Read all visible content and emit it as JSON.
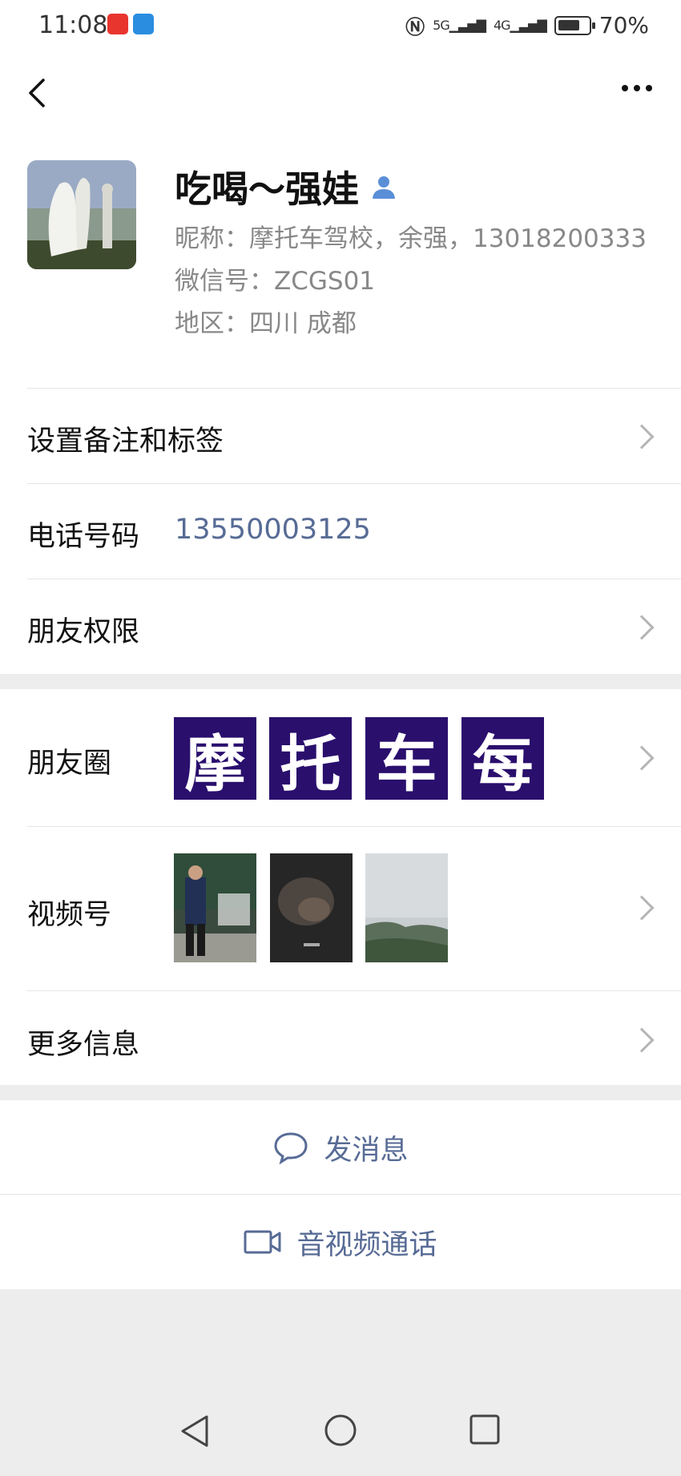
{
  "status_bar": {
    "time": "11:08",
    "signal_label": "5G",
    "signal_label_2": "4G",
    "battery": "70%"
  },
  "profile": {
    "name": "吃喝～强娃",
    "nickname": "昵称：摩托车驾校，余强，13018200333",
    "wechat_id": "微信号：ZCGS01",
    "region": "地区：四川  成都"
  },
  "rows": {
    "remark_label": "设置备注和标签",
    "phone_label": "电话号码",
    "phone_value": "13550003125",
    "permission_label": "朋友权限",
    "moments_label": "朋友圈",
    "moments_tiles": [
      "摩",
      "托",
      "车",
      "每"
    ],
    "channels_label": "视频号",
    "more_label": "更多信息"
  },
  "actions": {
    "message": "发消息",
    "call": "音视频通话"
  },
  "colors": {
    "link": "#576b95",
    "tile_bg": "#2a0f6d"
  }
}
